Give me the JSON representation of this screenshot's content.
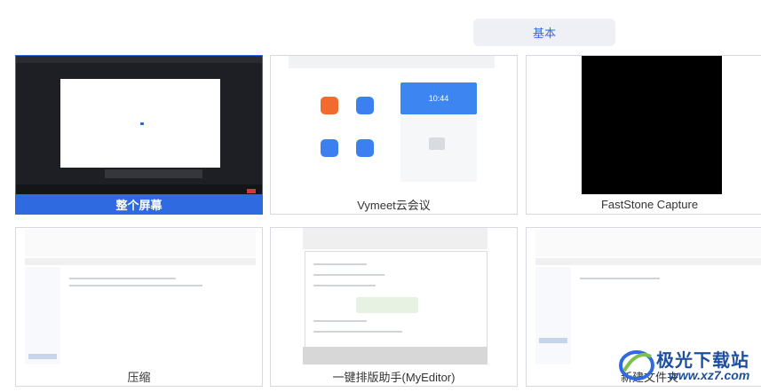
{
  "tabs": {
    "basic_label": "基本"
  },
  "windows": [
    {
      "label": "整个屏幕",
      "selected": true
    },
    {
      "label": "Vymeet云会议",
      "selected": false
    },
    {
      "label": "FastStone Capture",
      "selected": false
    },
    {
      "label": "压缩",
      "selected": false
    },
    {
      "label": "一键排版助手(MyEditor)",
      "selected": false
    },
    {
      "label": "新建文件夹",
      "selected": false
    }
  ],
  "vymeet": {
    "clock": "10:44"
  },
  "watermark": {
    "text": "极光下载站",
    "url": "www.xz7.com"
  },
  "colors": {
    "accent": "#2f6ae0",
    "zoom_orange": "#f26a2e",
    "zoom_blue": "#3b7ff0"
  }
}
